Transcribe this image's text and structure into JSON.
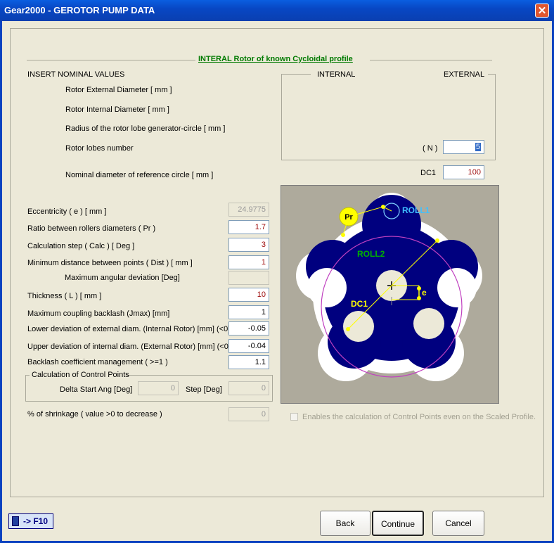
{
  "window": {
    "title": "Gear2000 - GEROTOR PUMP DATA",
    "close": "✕"
  },
  "header": {
    "section_title": "INTERAL Rotor of known Cycloidal profile"
  },
  "nominal": {
    "heading": "INSERT NOMINAL VALUES",
    "rotor_ext_diam": "Rotor External Diameter [ mm ]",
    "rotor_int_diam": "Rotor Internal Diameter [ mm ]",
    "lobe_radius": "Radius of the rotor lobe generator-circle [ mm ]",
    "lobes_number": "Rotor lobes number",
    "ref_circle": "Nominal diameter of reference circle [ mm ]"
  },
  "columns": {
    "internal": "INTERNAL",
    "external": "EXTERNAL"
  },
  "n_label": "( N )",
  "n_value": "5",
  "dc1_label": "DC1",
  "dc1_value": "100",
  "params": [
    {
      "label": "Eccentricity  ( e ) [ mm ]",
      "value": "24.9775"
    },
    {
      "label": "Ratio between rollers diameters ( Pr )",
      "value": "1.7"
    },
    {
      "label": "Calculation step ( Calc ) [ Deg ]",
      "value": "3"
    },
    {
      "label": "Minimum distance between points ( Dist ) [ mm ]",
      "value": "1"
    },
    {
      "label": "Maximum angular deviation [Deg]",
      "value": ""
    },
    {
      "label": "Thickness ( L ) [ mm ]",
      "value": "10"
    },
    {
      "label": "Maximum coupling backlash (Jmax) [mm]",
      "value": "1"
    },
    {
      "label": "Lower deviation of external diam. (Internal Rotor) [mm] (<0)",
      "value": "-0.05"
    },
    {
      "label": "Upper deviation of internal diam. (External Rotor) [mm] (<0)",
      "value": "-0.04"
    },
    {
      "label": "Backlash coefficient management ( >=1 )",
      "value": "1.1"
    }
  ],
  "control_points": {
    "legend": "Calculation of Control Points",
    "delta_label": "Delta Start Ang [Deg]",
    "delta_value": "0",
    "step_label": "Step [Deg]",
    "step_value": "0"
  },
  "shrinkage": {
    "label": "% of shrinkage ( value >0 to decrease )",
    "value": "0"
  },
  "diagram": {
    "pr": "Pr",
    "roll1": "ROLL1",
    "roll2": "ROLL2",
    "dc1": "DC1",
    "e": "e"
  },
  "scaled_checkbox": "Enables the calculation of Control Points even on the Scaled Profile.",
  "calc_button": "-> F10",
  "buttons": {
    "back": "Back",
    "continue": "Continue",
    "cancel": "Cancel"
  },
  "colors": {
    "title_bar": "#0a5ee0",
    "rotor": "#00007f",
    "diagram_bg": "#aeaa9c",
    "accent_green": "#007a00"
  }
}
